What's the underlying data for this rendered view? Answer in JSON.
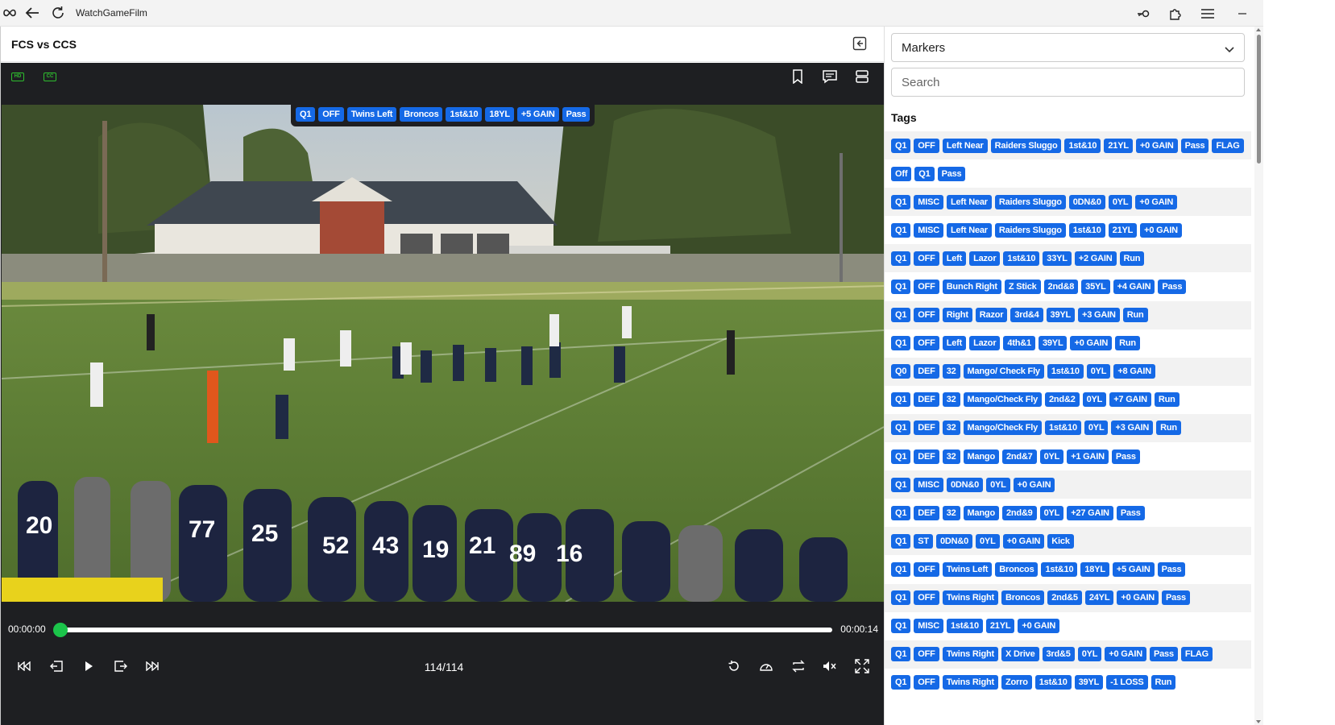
{
  "window": {
    "app_title": "WatchGameFilm",
    "icons": [
      "infinity-icon",
      "back-arrow-icon",
      "refresh-icon",
      "key-icon",
      "extension-icon",
      "menu-icon",
      "minimize-icon",
      "maximize-icon",
      "close-icon"
    ]
  },
  "header": {
    "title": "FCS vs CCS"
  },
  "player": {
    "hd_label": "HD",
    "cc_label": "CC",
    "current_tags": [
      "Q1",
      "OFF",
      "Twins Left",
      "Broncos",
      "1st&10",
      "18YL",
      "+5 GAIN",
      "Pass"
    ],
    "time_current": "00:00:00",
    "time_end": "00:00:14",
    "progress": 0.0,
    "counter": "114/114",
    "accent_color": "#1bc44a"
  },
  "panel": {
    "select_value": "Markers",
    "search_placeholder": "Search",
    "tags_heading": "Tags",
    "tag_color": "#1569e6",
    "rows": [
      [
        "Q1",
        "OFF",
        "Left Near",
        "Raiders Sluggo",
        "1st&10",
        "21YL",
        "+0 GAIN",
        "Pass",
        "FLAG"
      ],
      [
        "Off",
        "Q1",
        "Pass"
      ],
      [
        "Q1",
        "MISC",
        "Left Near",
        "Raiders Sluggo",
        "0DN&0",
        "0YL",
        "+0 GAIN"
      ],
      [
        "Q1",
        "MISC",
        "Left Near",
        "Raiders Sluggo",
        "1st&10",
        "21YL",
        "+0 GAIN"
      ],
      [
        "Q1",
        "OFF",
        "Left",
        "Lazor",
        "1st&10",
        "33YL",
        "+2 GAIN",
        "Run"
      ],
      [
        "Q1",
        "OFF",
        "Bunch Right",
        "Z Stick",
        "2nd&8",
        "35YL",
        "+4 GAIN",
        "Pass"
      ],
      [
        "Q1",
        "OFF",
        "Right",
        "Razor",
        "3rd&4",
        "39YL",
        "+3 GAIN",
        "Run"
      ],
      [
        "Q1",
        "OFF",
        "Left",
        "Lazor",
        "4th&1",
        "39YL",
        "+0 GAIN",
        "Run"
      ],
      [
        "Q0",
        "DEF",
        "32",
        "Mango/ Check Fly",
        "1st&10",
        "0YL",
        "+8 GAIN"
      ],
      [
        "Q1",
        "DEF",
        "32",
        "Mango/Check Fly",
        "2nd&2",
        "0YL",
        "+7 GAIN",
        "Run"
      ],
      [
        "Q1",
        "DEF",
        "32",
        "Mango/Check Fly",
        "1st&10",
        "0YL",
        "+3 GAIN",
        "Run"
      ],
      [
        "Q1",
        "DEF",
        "32",
        "Mango",
        "2nd&7",
        "0YL",
        "+1 GAIN",
        "Pass"
      ],
      [
        "Q1",
        "MISC",
        "0DN&0",
        "0YL",
        "+0 GAIN"
      ],
      [
        "Q1",
        "DEF",
        "32",
        "Mango",
        "2nd&9",
        "0YL",
        "+27 GAIN",
        "Pass"
      ],
      [
        "Q1",
        "ST",
        "0DN&0",
        "0YL",
        "+0 GAIN",
        "Kick"
      ],
      [
        "Q1",
        "OFF",
        "Twins Left",
        "Broncos",
        "1st&10",
        "18YL",
        "+5 GAIN",
        "Pass"
      ],
      [
        "Q1",
        "OFF",
        "Twins Right",
        "Broncos",
        "2nd&5",
        "24YL",
        "+0 GAIN",
        "Pass"
      ],
      [
        "Q1",
        "MISC",
        "1st&10",
        "21YL",
        "+0 GAIN"
      ],
      [
        "Q1",
        "OFF",
        "Twins Right",
        "X Drive",
        "3rd&5",
        "0YL",
        "+0 GAIN",
        "Pass",
        "FLAG"
      ],
      [
        "Q1",
        "OFF",
        "Twins Right",
        "Zorro",
        "1st&10",
        "39YL",
        "-1 LOSS",
        "Run"
      ]
    ]
  }
}
